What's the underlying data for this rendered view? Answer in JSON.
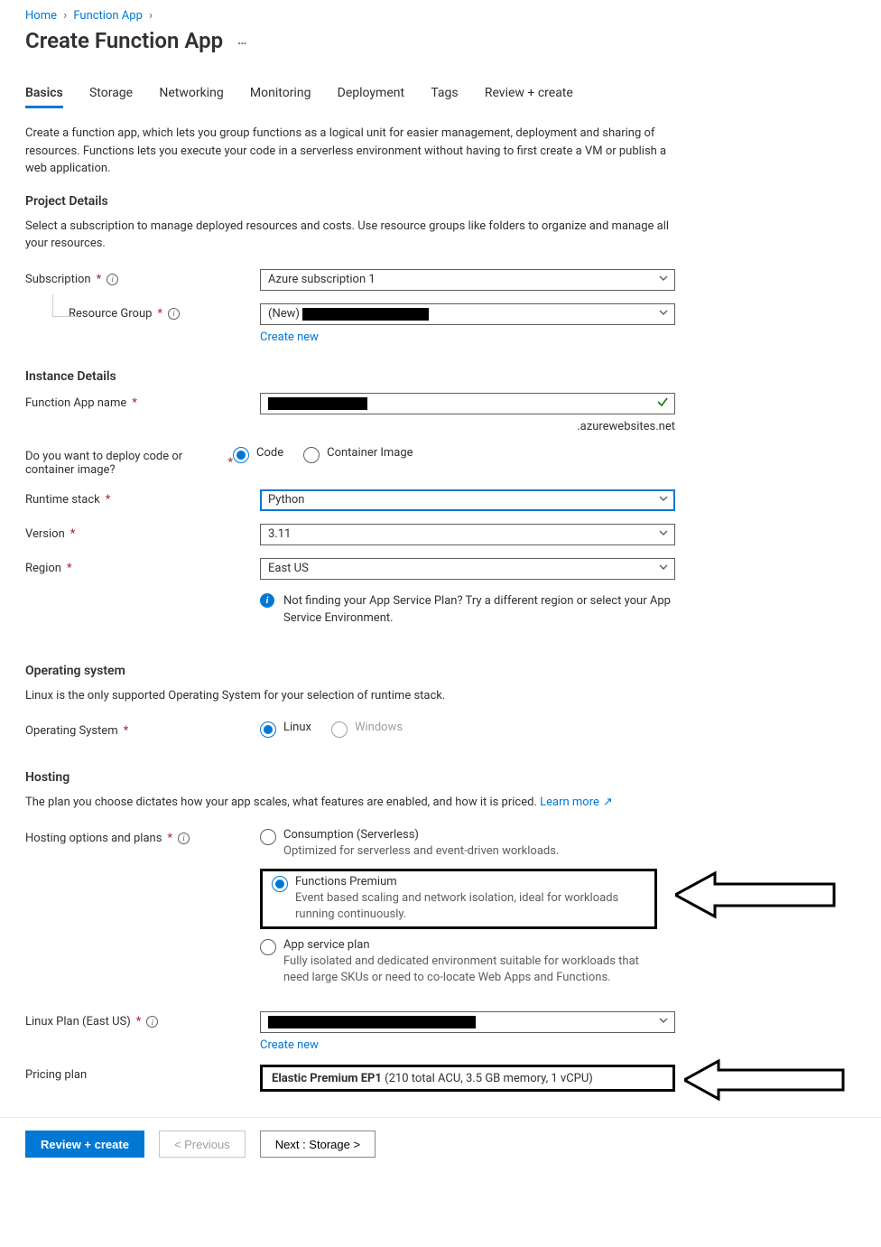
{
  "breadcrumb": {
    "home": "Home",
    "parent": "Function App"
  },
  "page_title": "Create Function App",
  "tabs": [
    "Basics",
    "Storage",
    "Networking",
    "Monitoring",
    "Deployment",
    "Tags",
    "Review + create"
  ],
  "intro": "Create a function app, which lets you group functions as a logical unit for easier management, deployment and sharing of resources. Functions lets you execute your code in a serverless environment without having to first create a VM or publish a web application.",
  "sections": {
    "project": {
      "heading": "Project Details",
      "desc": "Select a subscription to manage deployed resources and costs. Use resource groups like folders to organize and manage all your resources.",
      "subscription_label": "Subscription",
      "subscription_value": "Azure subscription 1",
      "rg_label": "Resource Group",
      "rg_prefix": "(New)",
      "create_new": "Create new"
    },
    "instance": {
      "heading": "Instance Details",
      "name_label": "Function App name",
      "name_suffix": ".azurewebsites.net",
      "deploy_label": "Do you want to deploy code or container image?",
      "deploy_code": "Code",
      "deploy_container": "Container Image",
      "runtime_label": "Runtime stack",
      "runtime_value": "Python",
      "version_label": "Version",
      "version_value": "3.11",
      "region_label": "Region",
      "region_value": "East US",
      "region_hint": "Not finding your App Service Plan? Try a different region or select your App Service Environment."
    },
    "os": {
      "heading": "Operating system",
      "desc": "Linux is the only supported Operating System for your selection of runtime stack.",
      "label": "Operating System",
      "linux": "Linux",
      "windows": "Windows"
    },
    "hosting": {
      "heading": "Hosting",
      "desc": "The plan you choose dictates how your app scales, what features are enabled, and how it is priced. ",
      "learn_more": "Learn more",
      "options_label": "Hosting options and plans",
      "consumption_title": "Consumption (Serverless)",
      "consumption_desc": "Optimized for serverless and event-driven workloads.",
      "premium_title": "Functions Premium",
      "premium_desc": "Event based scaling and network isolation, ideal for workloads running continuously.",
      "asp_title": "App service plan",
      "asp_desc": "Fully isolated and dedicated environment suitable for workloads that need large SKUs or need to co-locate Web Apps and Functions.",
      "linux_plan_label": "Linux Plan (East US)",
      "create_new": "Create new",
      "pricing_label": "Pricing plan",
      "pricing_bold": "Elastic Premium EP1",
      "pricing_rest": " (210 total ACU, 3.5 GB memory, 1 vCPU)"
    }
  },
  "footer": {
    "review": "Review + create",
    "prev": "< Previous",
    "next": "Next : Storage >"
  }
}
